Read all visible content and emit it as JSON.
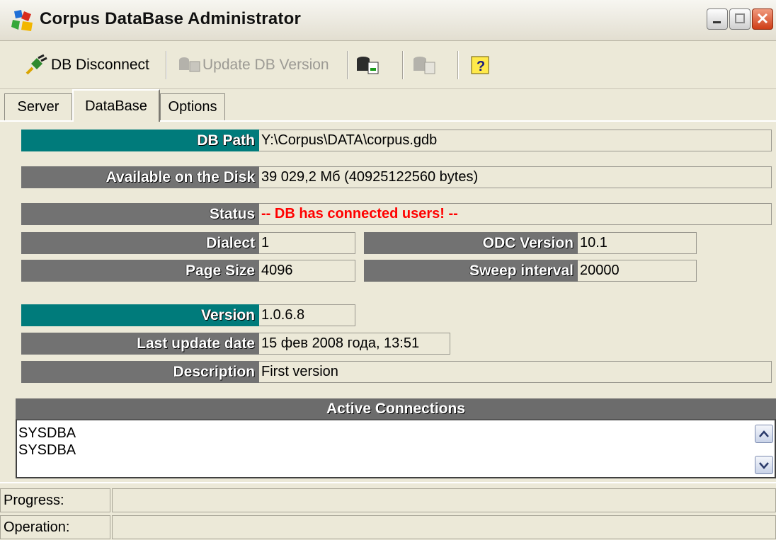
{
  "window": {
    "title": "Corpus DataBase Administrator",
    "icon": "database-app-icon"
  },
  "toolbar": {
    "disconnect_label": "DB Disconnect",
    "update_label": "Update DB Version",
    "backup_icon": "db-backup-icon",
    "restore_icon": "db-restore-icon",
    "help_icon": "help-icon"
  },
  "tabs": [
    {
      "label": "Server",
      "active": false
    },
    {
      "label": "DataBase",
      "active": true
    },
    {
      "label": "Options",
      "active": false
    }
  ],
  "fields": {
    "db_path": {
      "label": "DB Path",
      "value": "Y:\\Corpus\\DATA\\corpus.gdb"
    },
    "disk": {
      "label": "Available on the Disk",
      "value": "39 029,2 Мб (40925122560 bytes)"
    },
    "status": {
      "label": "Status",
      "value": "-- DB has connected users! --"
    },
    "dialect": {
      "label": "Dialect",
      "value": "1"
    },
    "odc": {
      "label": "ODC Version",
      "value": "10.1"
    },
    "page_size": {
      "label": "Page Size",
      "value": "4096"
    },
    "sweep": {
      "label": "Sweep interval",
      "value": "20000"
    },
    "version": {
      "label": "Version",
      "value": "1.0.6.8"
    },
    "last_update": {
      "label": "Last update date",
      "value": "15 фев 2008 года, 13:51"
    },
    "description": {
      "label": "Description",
      "value": "First version"
    }
  },
  "connections": {
    "header": "Active Connections",
    "items": [
      "SYSDBA",
      "SYSDBA"
    ]
  },
  "statusbar": {
    "progress_label": "Progress:",
    "operation_label": "Operation:"
  },
  "colors": {
    "teal_label": "#007b7b",
    "gray_label": "#727272",
    "status_red": "#ff0000"
  }
}
